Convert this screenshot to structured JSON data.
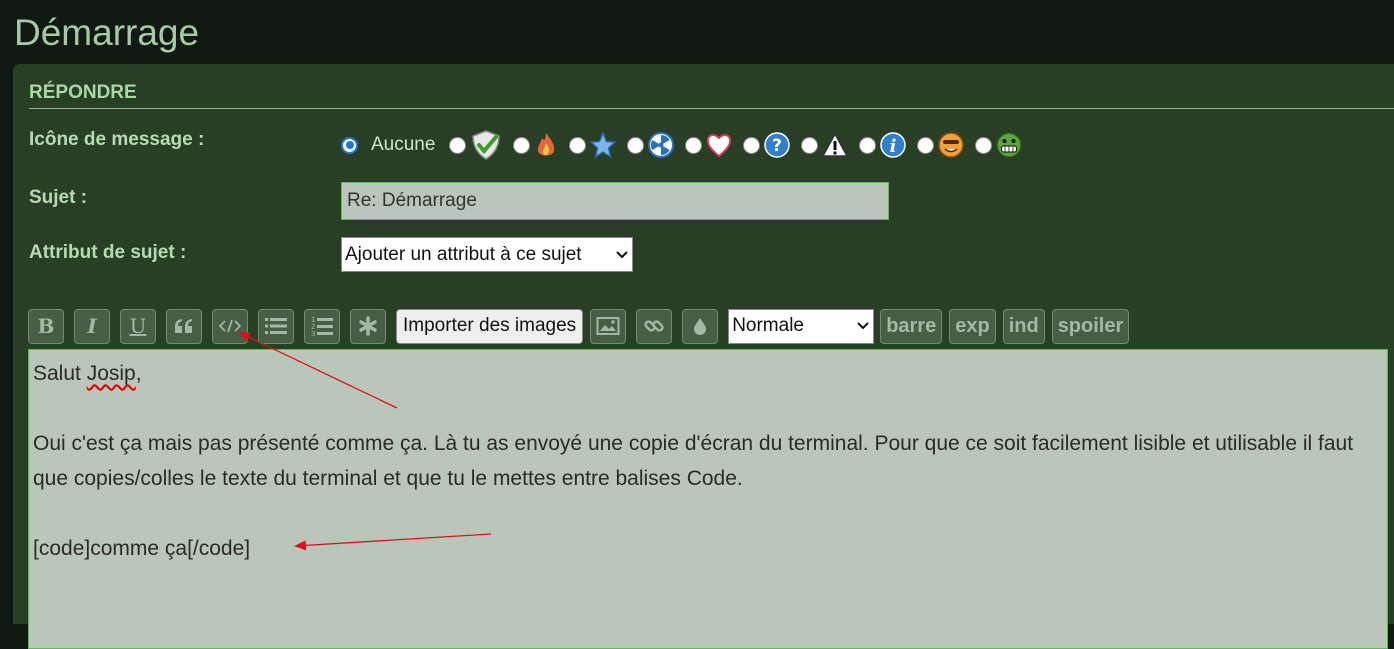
{
  "page": {
    "title": "Démarrage"
  },
  "reply": {
    "heading": "RÉPONDRE",
    "icon_label": "Icône de message :",
    "icon_none": "Aucune",
    "icons": [
      "check-shield-icon",
      "fire-icon",
      "star-icon",
      "radioactive-icon",
      "heart-icon",
      "question-icon",
      "warning-icon",
      "info-icon",
      "smiley-icon",
      "grin-icon"
    ],
    "subject_label": "Sujet :",
    "subject_value": "Re: Démarrage",
    "attr_label": "Attribut de sujet :",
    "attr_value": "Ajouter un attribut à ce sujet"
  },
  "toolbar": {
    "bold": "B",
    "italic": "I",
    "underline": "U",
    "import_images": "Importer des images",
    "size_value": "Normale",
    "strike": "barre",
    "sup": "exp",
    "sub": "ind",
    "spoiler": "spoiler"
  },
  "editor": {
    "line1_pre": "Salut ",
    "line1_word": "Josip",
    "line1_post": ",",
    "line2": "Oui c'est ça mais pas présenté comme ça. Là tu as envoyé une copie d'écran du terminal. Pour que ce soit facilement lisible et utilisable il faut que copies/colles le texte du terminal et que tu le mettes entre balises Code.",
    "line3": "[code]comme ça[/code]"
  },
  "colors": {
    "background": "#111a12",
    "panel": "#283f26",
    "label": "#b6dbb2",
    "annotation": "#e0101a"
  }
}
